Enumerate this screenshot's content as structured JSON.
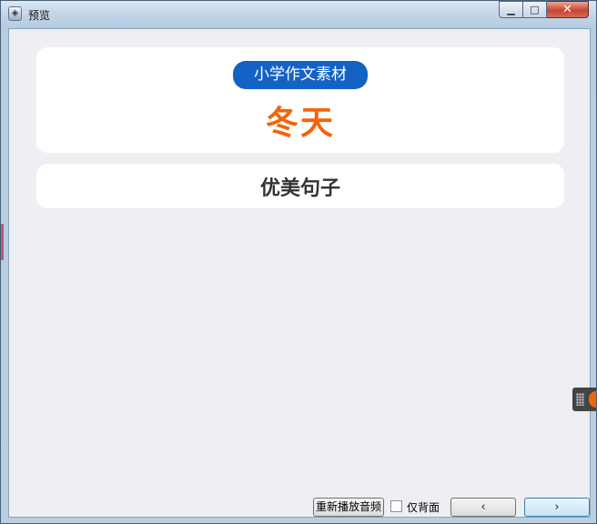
{
  "window": {
    "title": "预览",
    "controls": {
      "minimize": "▁",
      "maximize": "□",
      "close": "✕"
    }
  },
  "header_card": {
    "badge_text": "小学作文素材",
    "title": "冬天"
  },
  "section_card": {
    "title": "优美句子"
  },
  "bottom_bar": {
    "replay_label": "重新播放音频",
    "back_only_label": "仅背面",
    "back_only_checked": false,
    "prev_symbol": "‹",
    "next_symbol": "›"
  },
  "colors": {
    "accent_blue": "#1462c4",
    "title_orange": "#f3640b",
    "background": "#eeeff3"
  },
  "icons": [
    "app-icon",
    "minimize-icon",
    "maximize-icon",
    "close-icon",
    "chevron-left-icon",
    "chevron-right-icon"
  ]
}
